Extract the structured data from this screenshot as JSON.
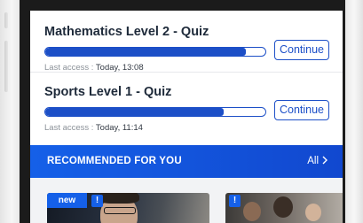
{
  "courses": [
    {
      "title": "Mathematics Level 2 - Quiz",
      "progress": 0.91,
      "last_access_label": "Last access : ",
      "last_access_time": "Today, 13:08",
      "button": "Continue"
    },
    {
      "title": "Sports Level 1 - Quiz",
      "progress": 0.81,
      "last_access_label": "Last access : ",
      "last_access_time": "Today, 11:14",
      "button": "Continue"
    }
  ],
  "recommended": {
    "heading": "RECOMMENDED FOR YOU",
    "all_label": "All",
    "cards": [
      {
        "badge_new": "new",
        "badge_alert": "!"
      },
      {
        "badge_alert": "!"
      }
    ]
  },
  "colors": {
    "accent": "#1c4fc7",
    "banner": "#1560e8"
  }
}
